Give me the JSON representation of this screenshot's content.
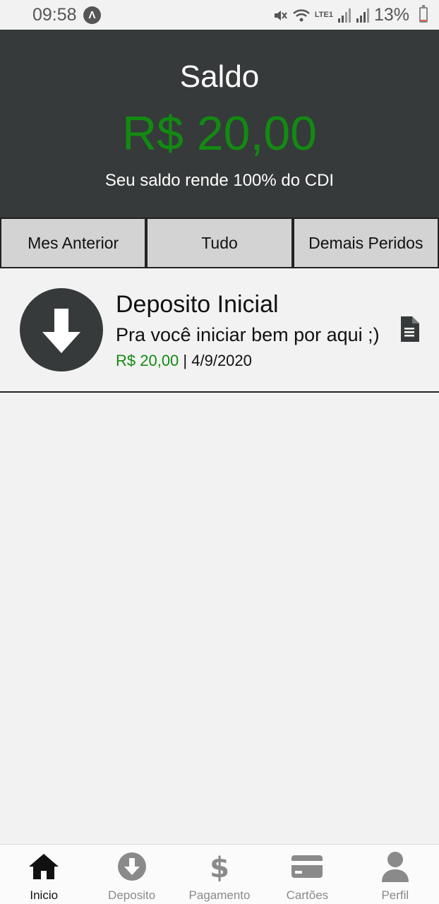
{
  "status_bar": {
    "time": "09:58",
    "app_icon": "app-notification-icon",
    "network": "LTE1",
    "battery_percent": "13%",
    "battery_level": 0.13,
    "icons": [
      "mute-icon",
      "wifi-icon",
      "volte-icon",
      "signal-icon",
      "signal-icon",
      "battery-icon"
    ]
  },
  "header": {
    "title": "Saldo",
    "amount": "R$ 20,00",
    "subtitle": "Seu saldo rende 100% do CDI"
  },
  "filters": [
    {
      "label": "Mes Anterior"
    },
    {
      "label": "Tudo"
    },
    {
      "label": "Demais Peridos"
    }
  ],
  "transactions": [
    {
      "icon": "arrow-down-icon",
      "title": "Deposito Inicial",
      "description": "Pra você iniciar bem por aqui ;)",
      "amount": "R$ 20,00",
      "separator": " | ",
      "date": "4/9/2020",
      "doc_icon": "document-icon"
    }
  ],
  "nav": [
    {
      "label": "Inicio",
      "icon": "home-icon",
      "active": true
    },
    {
      "label": "Deposito",
      "icon": "download-circle-icon",
      "active": false
    },
    {
      "label": "Pagamento",
      "icon": "dollar-icon",
      "active": false
    },
    {
      "label": "Cartões",
      "icon": "credit-card-icon",
      "active": false
    },
    {
      "label": "Perfil",
      "icon": "user-icon",
      "active": false
    }
  ],
  "colors": {
    "header_bg": "#363a3a",
    "accent_green": "#128a12",
    "filter_bg": "#d3d3d3",
    "page_bg": "#f2f2f2"
  }
}
